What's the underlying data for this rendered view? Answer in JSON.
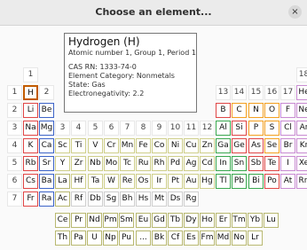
{
  "window": {
    "title": "Choose an element...",
    "close_glyph": "×"
  },
  "info": {
    "name": "Hydrogen (H)",
    "subtitle": "Atomic number 1, Group 1, Period 1",
    "cas": "CAS RN: 1333-74-0",
    "category": "Element Category: Nonmetals",
    "state": "State: Gas",
    "electronegativity": "Electronegativity: 2.2"
  },
  "selected_element": "H",
  "category_colors": {
    "nonmetal": "#f4a020",
    "noble": "#c98bd2",
    "alkali": "#e04646",
    "alkaline": "#3d64c8",
    "transition": "#cfcf8a",
    "post": "#3aa84f",
    "metalloid": "#e04646",
    "halogen": "#c98bd2",
    "unknown": "#cfcfcf",
    "lanthanide": "#b8b870",
    "actinide": "#b8b870"
  },
  "groups": [
    {
      "label": "1",
      "col": 1,
      "row": 1
    },
    {
      "label": "2",
      "col": 2,
      "row": 2
    },
    {
      "label": "3",
      "col": 3,
      "row": 4
    },
    {
      "label": "4",
      "col": 4,
      "row": 4
    },
    {
      "label": "5",
      "col": 5,
      "row": 4
    },
    {
      "label": "6",
      "col": 6,
      "row": 4
    },
    {
      "label": "7",
      "col": 7,
      "row": 4
    },
    {
      "label": "8",
      "col": 8,
      "row": 4
    },
    {
      "label": "9",
      "col": 9,
      "row": 4
    },
    {
      "label": "10",
      "col": 10,
      "row": 4
    },
    {
      "label": "11",
      "col": 11,
      "row": 4
    },
    {
      "label": "12",
      "col": 12,
      "row": 4
    },
    {
      "label": "13",
      "col": 13,
      "row": 2
    },
    {
      "label": "14",
      "col": 14,
      "row": 2
    },
    {
      "label": "15",
      "col": 15,
      "row": 2
    },
    {
      "label": "16",
      "col": 16,
      "row": 2
    },
    {
      "label": "17",
      "col": 17,
      "row": 2
    },
    {
      "label": "18",
      "col": 18,
      "row": 1
    }
  ],
  "periods": [
    "1",
    "2",
    "3",
    "4",
    "5",
    "6",
    "7"
  ],
  "elements": [
    {
      "s": "H",
      "c": 1,
      "r": 2,
      "cat": "nonmetal"
    },
    {
      "s": "He",
      "c": 18,
      "r": 2,
      "cat": "noble"
    },
    {
      "s": "Li",
      "c": 1,
      "r": 3,
      "cat": "alkali"
    },
    {
      "s": "Be",
      "c": 2,
      "r": 3,
      "cat": "alkaline"
    },
    {
      "s": "B",
      "c": 13,
      "r": 3,
      "cat": "metalloid"
    },
    {
      "s": "C",
      "c": 14,
      "r": 3,
      "cat": "nonmetal"
    },
    {
      "s": "N",
      "c": 15,
      "r": 3,
      "cat": "nonmetal"
    },
    {
      "s": "O",
      "c": 16,
      "r": 3,
      "cat": "nonmetal"
    },
    {
      "s": "F",
      "c": 17,
      "r": 3,
      "cat": "halogen"
    },
    {
      "s": "Ne",
      "c": 18,
      "r": 3,
      "cat": "noble"
    },
    {
      "s": "Na",
      "c": 1,
      "r": 4,
      "cat": "alkali"
    },
    {
      "s": "Mg",
      "c": 2,
      "r": 4,
      "cat": "alkaline"
    },
    {
      "s": "Al",
      "c": 13,
      "r": 4,
      "cat": "post"
    },
    {
      "s": "Si",
      "c": 14,
      "r": 4,
      "cat": "metalloid"
    },
    {
      "s": "P",
      "c": 15,
      "r": 4,
      "cat": "nonmetal"
    },
    {
      "s": "S",
      "c": 16,
      "r": 4,
      "cat": "nonmetal"
    },
    {
      "s": "Cl",
      "c": 17,
      "r": 4,
      "cat": "halogen"
    },
    {
      "s": "Ar",
      "c": 18,
      "r": 4,
      "cat": "noble"
    },
    {
      "s": "K",
      "c": 1,
      "r": 5,
      "cat": "alkali"
    },
    {
      "s": "Ca",
      "c": 2,
      "r": 5,
      "cat": "alkaline"
    },
    {
      "s": "Sc",
      "c": 3,
      "r": 5,
      "cat": "transition"
    },
    {
      "s": "Ti",
      "c": 4,
      "r": 5,
      "cat": "transition"
    },
    {
      "s": "V",
      "c": 5,
      "r": 5,
      "cat": "transition"
    },
    {
      "s": "Cr",
      "c": 6,
      "r": 5,
      "cat": "transition"
    },
    {
      "s": "Mn",
      "c": 7,
      "r": 5,
      "cat": "transition"
    },
    {
      "s": "Fe",
      "c": 8,
      "r": 5,
      "cat": "transition"
    },
    {
      "s": "Co",
      "c": 9,
      "r": 5,
      "cat": "transition"
    },
    {
      "s": "Ni",
      "c": 10,
      "r": 5,
      "cat": "transition"
    },
    {
      "s": "Cu",
      "c": 11,
      "r": 5,
      "cat": "transition"
    },
    {
      "s": "Zn",
      "c": 12,
      "r": 5,
      "cat": "transition"
    },
    {
      "s": "Ga",
      "c": 13,
      "r": 5,
      "cat": "post"
    },
    {
      "s": "Ge",
      "c": 14,
      "r": 5,
      "cat": "metalloid"
    },
    {
      "s": "As",
      "c": 15,
      "r": 5,
      "cat": "metalloid"
    },
    {
      "s": "Se",
      "c": 16,
      "r": 5,
      "cat": "nonmetal"
    },
    {
      "s": "Br",
      "c": 17,
      "r": 5,
      "cat": "halogen"
    },
    {
      "s": "Kr",
      "c": 18,
      "r": 5,
      "cat": "noble"
    },
    {
      "s": "Rb",
      "c": 1,
      "r": 6,
      "cat": "alkali"
    },
    {
      "s": "Sr",
      "c": 2,
      "r": 6,
      "cat": "alkaline"
    },
    {
      "s": "Y",
      "c": 3,
      "r": 6,
      "cat": "transition"
    },
    {
      "s": "Zr",
      "c": 4,
      "r": 6,
      "cat": "transition"
    },
    {
      "s": "Nb",
      "c": 5,
      "r": 6,
      "cat": "transition"
    },
    {
      "s": "Mo",
      "c": 6,
      "r": 6,
      "cat": "transition"
    },
    {
      "s": "Tc",
      "c": 7,
      "r": 6,
      "cat": "transition"
    },
    {
      "s": "Ru",
      "c": 8,
      "r": 6,
      "cat": "transition"
    },
    {
      "s": "Rh",
      "c": 9,
      "r": 6,
      "cat": "transition"
    },
    {
      "s": "Pd",
      "c": 10,
      "r": 6,
      "cat": "transition"
    },
    {
      "s": "Ag",
      "c": 11,
      "r": 6,
      "cat": "transition"
    },
    {
      "s": "Cd",
      "c": 12,
      "r": 6,
      "cat": "transition"
    },
    {
      "s": "In",
      "c": 13,
      "r": 6,
      "cat": "post"
    },
    {
      "s": "Sn",
      "c": 14,
      "r": 6,
      "cat": "post"
    },
    {
      "s": "Sb",
      "c": 15,
      "r": 6,
      "cat": "metalloid"
    },
    {
      "s": "Te",
      "c": 16,
      "r": 6,
      "cat": "metalloid"
    },
    {
      "s": "I",
      "c": 17,
      "r": 6,
      "cat": "halogen"
    },
    {
      "s": "Xe",
      "c": 18,
      "r": 6,
      "cat": "noble"
    },
    {
      "s": "Cs",
      "c": 1,
      "r": 7,
      "cat": "alkali"
    },
    {
      "s": "Ba",
      "c": 2,
      "r": 7,
      "cat": "alkaline"
    },
    {
      "s": "La",
      "c": 3,
      "r": 7,
      "cat": "lanthanide"
    },
    {
      "s": "Hf",
      "c": 4,
      "r": 7,
      "cat": "transition"
    },
    {
      "s": "Ta",
      "c": 5,
      "r": 7,
      "cat": "transition"
    },
    {
      "s": "W",
      "c": 6,
      "r": 7,
      "cat": "transition"
    },
    {
      "s": "Re",
      "c": 7,
      "r": 7,
      "cat": "transition"
    },
    {
      "s": "Os",
      "c": 8,
      "r": 7,
      "cat": "transition"
    },
    {
      "s": "Ir",
      "c": 9,
      "r": 7,
      "cat": "transition"
    },
    {
      "s": "Pt",
      "c": 10,
      "r": 7,
      "cat": "transition"
    },
    {
      "s": "Au",
      "c": 11,
      "r": 7,
      "cat": "transition"
    },
    {
      "s": "Hg",
      "c": 12,
      "r": 7,
      "cat": "transition"
    },
    {
      "s": "Tl",
      "c": 13,
      "r": 7,
      "cat": "post"
    },
    {
      "s": "Pb",
      "c": 14,
      "r": 7,
      "cat": "post"
    },
    {
      "s": "Bi",
      "c": 15,
      "r": 7,
      "cat": "post"
    },
    {
      "s": "Po",
      "c": 16,
      "r": 7,
      "cat": "metalloid"
    },
    {
      "s": "At",
      "c": 17,
      "r": 7,
      "cat": "halogen"
    },
    {
      "s": "Rn",
      "c": 18,
      "r": 7,
      "cat": "noble"
    },
    {
      "s": "Fr",
      "c": 1,
      "r": 8,
      "cat": "alkali"
    },
    {
      "s": "Ra",
      "c": 2,
      "r": 8,
      "cat": "alkaline"
    },
    {
      "s": "Ac",
      "c": 3,
      "r": 8,
      "cat": "actinide"
    },
    {
      "s": "Rf",
      "c": 4,
      "r": 8,
      "cat": "unknown"
    },
    {
      "s": "Db",
      "c": 5,
      "r": 8,
      "cat": "unknown"
    },
    {
      "s": "Sg",
      "c": 6,
      "r": 8,
      "cat": "unknown"
    },
    {
      "s": "Bh",
      "c": 7,
      "r": 8,
      "cat": "unknown"
    },
    {
      "s": "Hs",
      "c": 8,
      "r": 8,
      "cat": "unknown"
    },
    {
      "s": "Mt",
      "c": 9,
      "r": 8,
      "cat": "unknown"
    },
    {
      "s": "Ds",
      "c": 10,
      "r": 8,
      "cat": "unknown"
    },
    {
      "s": "Rg",
      "c": 11,
      "r": 8,
      "cat": "unknown"
    }
  ],
  "lanthanides": [
    "Ce",
    "Pr",
    "Nd",
    "Pm",
    "Sm",
    "Eu",
    "Gd",
    "Tb",
    "Dy",
    "Ho",
    "Er",
    "Tm",
    "Yb",
    "Lu"
  ],
  "actinides": [
    "Th",
    "Pa",
    "U",
    "Np",
    "Pu",
    "...",
    "Bk",
    "Cf",
    "Es",
    "Fm",
    "Md",
    "No",
    "Lr"
  ]
}
